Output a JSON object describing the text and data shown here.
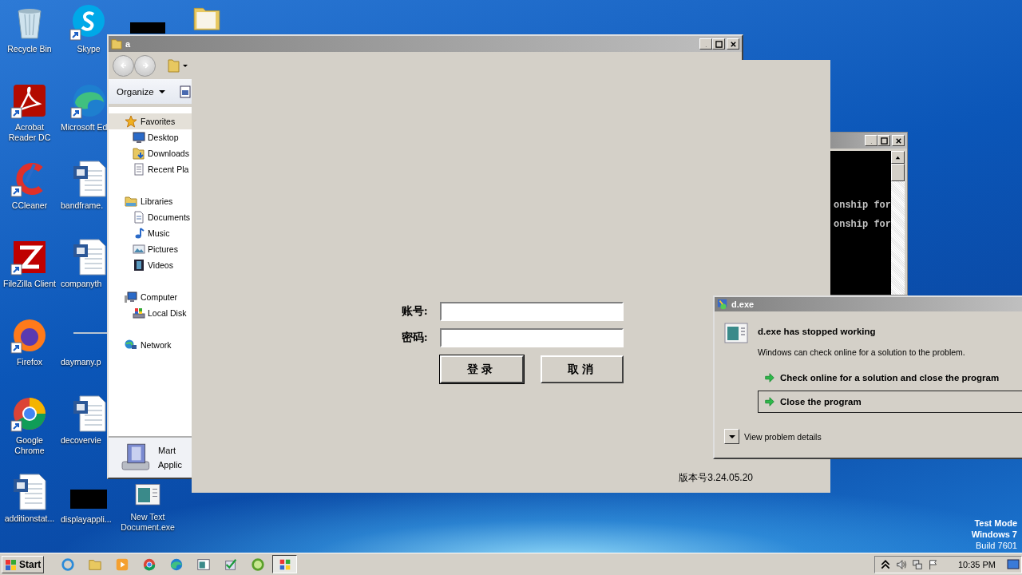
{
  "desktop_icons": [
    {
      "label": "Recycle Bin",
      "kind": "recycle",
      "shortcut": false
    },
    {
      "label": "Acrobat Reader DC",
      "kind": "pdf",
      "shortcut": true
    },
    {
      "label": "CCleaner",
      "kind": "ccleaner",
      "shortcut": true
    },
    {
      "label": "FileZilla Client",
      "kind": "filezilla",
      "shortcut": true
    },
    {
      "label": "Firefox",
      "kind": "firefox",
      "shortcut": true
    },
    {
      "label": "Google Chrome",
      "kind": "chrome",
      "shortcut": true
    },
    {
      "label": "additionstat...",
      "kind": "word",
      "shortcut": false
    },
    {
      "label": "Skype",
      "kind": "skype",
      "shortcut": true
    },
    {
      "label": "Microsoft Ed",
      "kind": "edge",
      "shortcut": true
    },
    {
      "label": "bandframe.",
      "kind": "word",
      "shortcut": false
    },
    {
      "label": "companyth",
      "kind": "word",
      "shortcut": false
    },
    {
      "label": "daymany.p",
      "kind": "line",
      "shortcut": false
    },
    {
      "label": "decovervie",
      "kind": "word",
      "shortcut": false
    },
    {
      "label": "displayappli...",
      "kind": "blank",
      "shortcut": false
    },
    {
      "kind": "blank",
      "shortcut": false
    },
    {
      "kind": "folder",
      "shortcut": false
    },
    {
      "label": "New Text Document.exe",
      "kind": "exe",
      "shortcut": false
    }
  ],
  "explorer": {
    "title": "a",
    "organize": "Organize",
    "nav": [
      {
        "label": "Favorites",
        "kind": "star",
        "selected": true,
        "children": [
          {
            "label": "Desktop",
            "kind": "desktop",
            "selected": false
          },
          {
            "label": "Downloads",
            "kind": "downloads",
            "selected": false
          },
          {
            "label": "Recent Pla",
            "kind": "recent",
            "selected": false
          }
        ]
      },
      {
        "label": "Libraries",
        "kind": "library",
        "selected": false,
        "children": [
          {
            "label": "Documents",
            "kind": "document",
            "selected": false
          },
          {
            "label": "Music",
            "kind": "music",
            "selected": false
          },
          {
            "label": "Pictures",
            "kind": "pictures",
            "selected": false
          },
          {
            "label": "Videos",
            "kind": "videos",
            "selected": false
          }
        ]
      },
      {
        "label": "Computer",
        "kind": "computer",
        "selected": false,
        "children": [
          {
            "label": "Local Disk",
            "kind": "disk",
            "selected": false
          }
        ]
      },
      {
        "label": "Network",
        "kind": "network",
        "selected": false
      }
    ],
    "details": {
      "name": "Mart",
      "type": "Applic"
    }
  },
  "console": {
    "lines": [
      "onship for",
      "onship for"
    ]
  },
  "login": {
    "fields": [
      {
        "label": "账号:"
      },
      {
        "label": "密码:"
      }
    ],
    "buttons": [
      {
        "label": "登录",
        "default": true
      },
      {
        "label": "取消",
        "default": false
      }
    ],
    "version": "版本号3.24.05.20"
  },
  "error_dialog": {
    "title": "d.exe",
    "heading": "d.exe has stopped working",
    "message": "Windows can check online for a solution to the problem.",
    "options": [
      {
        "label": "Check online for a solution and close the program",
        "selected": false
      },
      {
        "label": "Close the program",
        "selected": true
      }
    ],
    "details": "View problem details"
  },
  "system_notice": [
    "Test Mode",
    "Windows 7",
    "Build 7601"
  ],
  "taskbar": {
    "start": "Start",
    "apps": [
      {
        "kind": "ie",
        "selected": false
      },
      {
        "kind": "explorer",
        "selected": false
      },
      {
        "kind": "media",
        "selected": false
      },
      {
        "kind": "chrome",
        "selected": false
      },
      {
        "kind": "edge",
        "selected": false
      },
      {
        "kind": "window",
        "selected": false
      },
      {
        "kind": "check",
        "selected": false
      },
      {
        "kind": "ring",
        "selected": false
      },
      {
        "kind": "tiles",
        "selected": true
      }
    ],
    "time": "10:35 PM"
  }
}
